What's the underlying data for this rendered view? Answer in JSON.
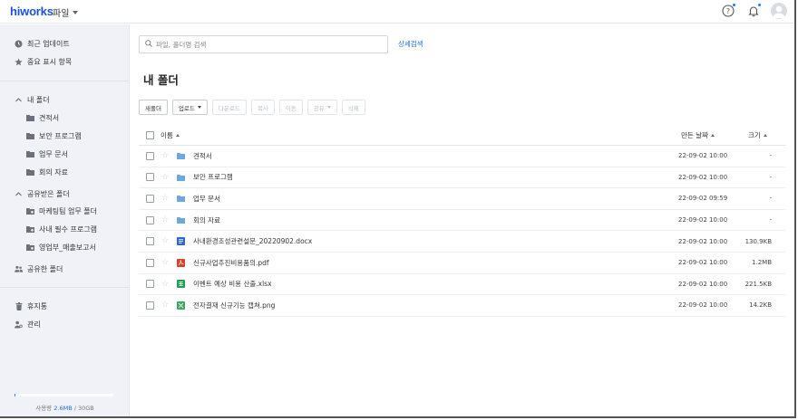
{
  "header": {
    "logo": "hiworks",
    "app_name": "파일",
    "icons": [
      "help-icon",
      "bell-icon",
      "avatar"
    ],
    "accent": "#1c52d6"
  },
  "sidebar": {
    "top_items": [
      {
        "label": "최근 업데이트",
        "icon": "clock-icon"
      },
      {
        "label": "중요 표시 항목",
        "icon": "star-icon"
      }
    ],
    "my_folder": {
      "label": "내 폴더",
      "items": [
        {
          "label": "견적서",
          "icon": "folder-icon"
        },
        {
          "label": "보안 프로그램",
          "icon": "folder-icon"
        },
        {
          "label": "업무 문서",
          "icon": "folder-icon"
        },
        {
          "label": "회의 자료",
          "icon": "folder-icon"
        }
      ]
    },
    "shared_received": {
      "label": "공유받은 폴더",
      "items": [
        {
          "label": "마케팅팀 업무 폴더",
          "icon": "folder-icon"
        },
        {
          "label": "사내 필수 프로그램",
          "icon": "folder-icon"
        },
        {
          "label": "영업부_매출보고서",
          "icon": "folder-icon"
        }
      ]
    },
    "shared_sent": {
      "label": "공유한 폴더",
      "icon": "users-icon"
    },
    "bottom_items": [
      {
        "label": "휴지통",
        "icon": "trash-icon"
      },
      {
        "label": "관리",
        "icon": "admin-icon"
      }
    ],
    "usage": {
      "label": "사용량",
      "used": "2.6MB",
      "total": "30GB",
      "used_fraction": 0.0001
    }
  },
  "main": {
    "search_placeholder": "파일, 폴더명 검색",
    "advanced_search": "상세검색",
    "title": "내 폴더",
    "toolbar": {
      "new_folder": "새폴더",
      "upload": "업로드",
      "download": "다운로드",
      "copy": "복사",
      "move": "이동",
      "share": "공유",
      "delete": "삭제"
    },
    "columns": {
      "name": "이름",
      "modified": "만든 날짜",
      "size": "크기"
    },
    "files": [
      {
        "name": "견적서",
        "type": "folder",
        "date": "22-09-02 10:00",
        "size": "-"
      },
      {
        "name": "보안 프로그램",
        "type": "folder",
        "date": "22-09-02 10:00",
        "size": "-"
      },
      {
        "name": "업무 문서",
        "type": "folder",
        "date": "22-09-02 09:59",
        "size": "-"
      },
      {
        "name": "회의 자료",
        "type": "folder",
        "date": "22-09-02 10:00",
        "size": "-"
      },
      {
        "name": "사내환경조성관련설문_20220902.docx",
        "type": "docx",
        "date": "22-09-02 10:00",
        "size": "130.9KB"
      },
      {
        "name": "신규사업추진비용품의.pdf",
        "type": "pdf",
        "date": "22-09-02 10:00",
        "size": "1.2MB"
      },
      {
        "name": "이벤트 예상 비용 산출.xlsx",
        "type": "xlsx",
        "date": "22-09-02 10:00",
        "size": "221.5KB"
      },
      {
        "name": "전자결재 신규기능 캡쳐.png",
        "type": "png",
        "date": "22-09-02 10:00",
        "size": "14.2KB"
      }
    ]
  },
  "colors": {
    "folder": "#6fa8e0",
    "docx": "#2b64d6",
    "pdf": "#d9412f",
    "xlsx": "#1f9d55",
    "png": "#3aa85a",
    "link": "#1c6ee8"
  }
}
